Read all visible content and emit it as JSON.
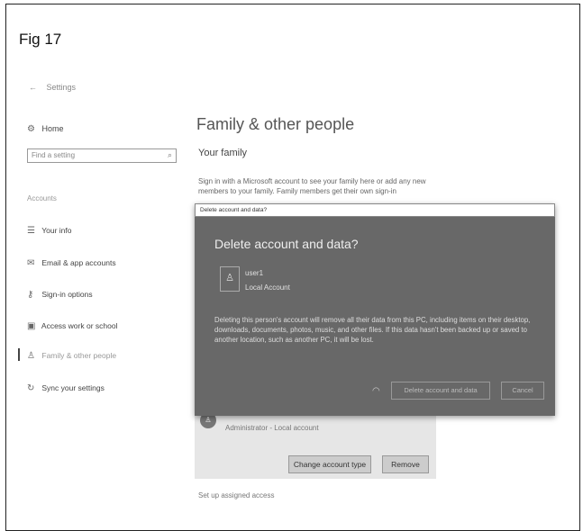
{
  "figure_label": "Fig 17",
  "window": {
    "back_title": "Settings"
  },
  "sidebar": {
    "home": "Home",
    "search_placeholder": "Find a setting",
    "section_label": "Accounts",
    "items": [
      {
        "label": "Your info",
        "icon": "person-icon"
      },
      {
        "label": "Email & app accounts",
        "icon": "mail-icon"
      },
      {
        "label": "Sign-in options",
        "icon": "key-icon"
      },
      {
        "label": "Access work or school",
        "icon": "briefcase-icon"
      },
      {
        "label": "Family & other people",
        "icon": "people-icon",
        "active": true
      },
      {
        "label": "Sync your settings",
        "icon": "sync-icon"
      }
    ]
  },
  "main": {
    "title": "Family & other people",
    "subtitle": "Your family",
    "description": "Sign in with a Microsoft account to see your family here or add any new members to your family. Family members get their own sign-in",
    "admin_account_label": "Administrator - Local account",
    "change_account_type": "Change account type",
    "remove": "Remove",
    "assigned_access": "Set up assigned access"
  },
  "dialog": {
    "window_title": "Delete account and data?",
    "heading": "Delete account and data?",
    "user_name": "user1",
    "user_type": "Local Account",
    "body": "Deleting this person's account will remove all their data from this PC, including items on their desktop, downloads, documents, photos, music, and other files. If this data hasn't been backed up or saved to another location, such as another PC, it will be lost.",
    "delete_button": "Delete account and data",
    "cancel_button": "Cancel"
  }
}
